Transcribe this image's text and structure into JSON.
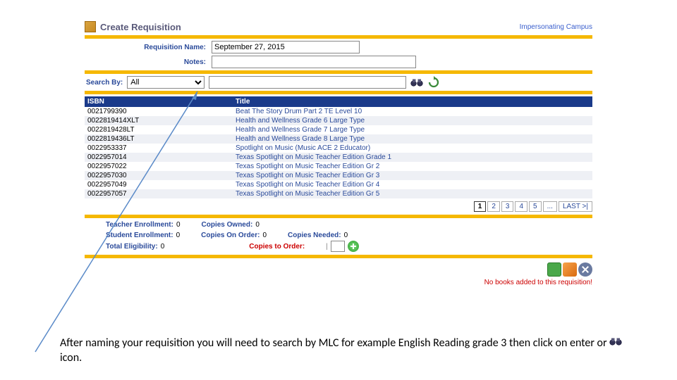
{
  "header": {
    "title": "Create Requisition",
    "impersonating": "Impersonating Campus"
  },
  "form": {
    "req_name_label": "Requisition Name:",
    "req_name_value": "September 27, 2015",
    "notes_label": "Notes:"
  },
  "search": {
    "label": "Search By:",
    "selected": "All",
    "placeholder": ""
  },
  "table": {
    "headers": {
      "isbn": "ISBN",
      "title": "Title"
    },
    "rows": [
      {
        "isbn": "0021799390",
        "title": "Beat The Story Drum Part 2 TE Level 10"
      },
      {
        "isbn": "0022819414XLT",
        "title": "Health and Wellness Grade 6 Large Type"
      },
      {
        "isbn": "0022819428LT",
        "title": "Health and Wellness Grade 7 Large Type"
      },
      {
        "isbn": "0022819436LT",
        "title": "Health and Wellness Grade 8 Large Type"
      },
      {
        "isbn": "0022953337",
        "title": "Spotlight on Music (Music ACE 2 Educator)"
      },
      {
        "isbn": "0022957014",
        "title": "Texas Spotlight on Music Teacher Edition Grade 1"
      },
      {
        "isbn": "0022957022",
        "title": "Texas Spotlight on Music Teacher Edition Gr 2"
      },
      {
        "isbn": "0022957030",
        "title": "Texas Spotlight on Music Teacher Edition Gr 3"
      },
      {
        "isbn": "0022957049",
        "title": "Texas Spotlight on Music Teacher Edition Gr 4"
      },
      {
        "isbn": "0022957057",
        "title": "Texas Spotlight on Music Teacher Edition Gr 5"
      }
    ]
  },
  "pager": {
    "current": "1",
    "p2": "2",
    "p3": "3",
    "p4": "4",
    "p5": "5",
    "ellipsis": "...",
    "last": "LAST >|"
  },
  "stats": {
    "teacher_enroll_label": "Teacher Enrollment:",
    "teacher_enroll_val": "0",
    "copies_owned_label": "Copies Owned:",
    "copies_owned_val": "0",
    "student_enroll_label": "Student Enrollment:",
    "student_enroll_val": "0",
    "copies_on_order_label": "Copies On Order:",
    "copies_on_order_val": "0",
    "copies_needed_label": "Copies Needed:",
    "copies_needed_val": "0",
    "total_elig_label": "Total Eligibility:",
    "total_elig_val": "0",
    "copies_to_order_label": "Copies to Order:"
  },
  "footer": {
    "no_books": "No books added to this requisition!"
  },
  "instruction": {
    "text_a": "After naming your requisition you will need to search by MLC for example English Reading grade 3 then click on enter or ",
    "text_b": " icon."
  }
}
